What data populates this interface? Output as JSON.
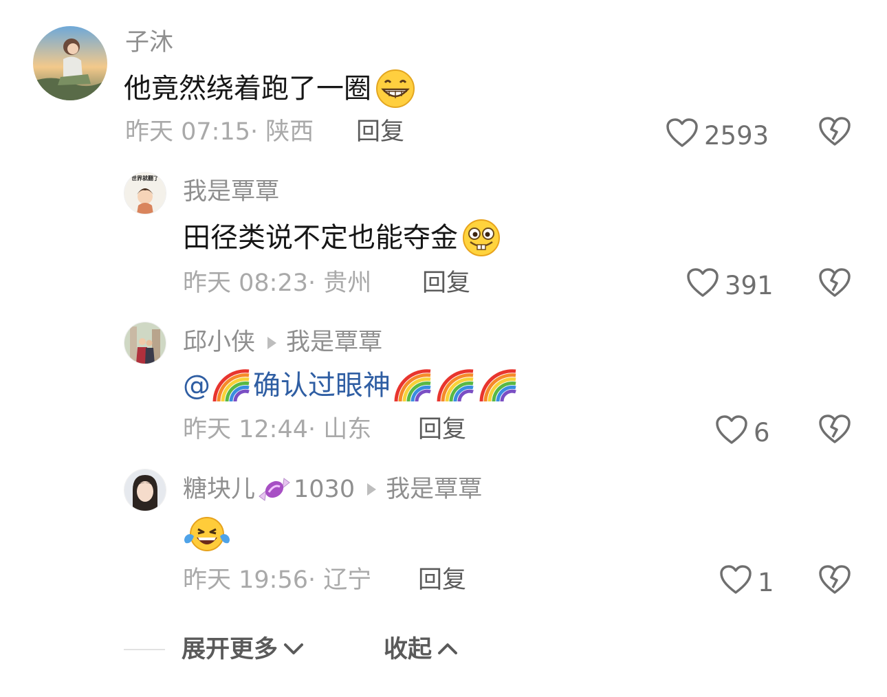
{
  "comments": [
    {
      "username": "子沐",
      "text": "他竟然绕着跑了一圈",
      "emoji": "grinning-emoji",
      "time": "昨天 07:15",
      "location": "陕西",
      "reply_label": "回复",
      "likes": "2593"
    },
    {
      "username": "我是覃覃",
      "text": "田径类说不定也能夺金",
      "emoji": "buck-tooth-emoji",
      "time": "昨天 08:23",
      "location": "贵州",
      "reply_label": "回复",
      "likes": "391",
      "avatar_caption": "世界就翻了"
    },
    {
      "username": "邱小侠",
      "reply_to": "我是覃覃",
      "at_sign": "@",
      "mention_text": "确认过眼神",
      "emoji": "rainbow-emoji",
      "time": "昨天 12:44",
      "location": "山东",
      "reply_label": "回复",
      "likes": "6"
    },
    {
      "username": "糖块儿",
      "badge_icon": "candy-icon",
      "badge_count": "1030",
      "reply_to": "我是覃覃",
      "emoji": "tears-of-joy-emoji",
      "time": "昨天 19:56",
      "location": "辽宁",
      "reply_label": "回复",
      "likes": "1"
    }
  ],
  "footer": {
    "expand_label": "展开更多",
    "collapse_label": "收起"
  },
  "colors": {
    "username": "#8f8f8f",
    "meta": "#a9a9a9",
    "mention": "#2f5ea3",
    "icon": "#6f6f6f"
  }
}
